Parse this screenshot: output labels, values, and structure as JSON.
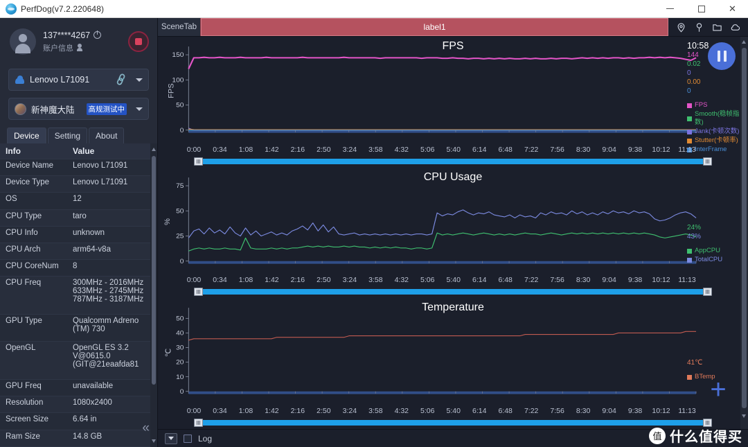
{
  "window": {
    "title": "PerfDog(v7.2.220648)",
    "logo_icon": "perfdog-logo-icon",
    "minimize_label": "—",
    "maximize_label": "□",
    "close_label": "✕"
  },
  "account": {
    "user_id": "137****4267",
    "power_icon": "power-icon",
    "sub_label": "账户信息",
    "person_icon": "person-add-icon",
    "stop_button_label": "stop-recording"
  },
  "device_select": {
    "icon": "android-icon",
    "value": "Lenovo L71091",
    "link_icon": "usb-link-icon",
    "caret_icon": "chevron-down-icon"
  },
  "app_select": {
    "icon": "app-thumbnail-icon",
    "value": "新神魔大陆",
    "badge": "高规测试中",
    "caret_icon": "chevron-down-icon"
  },
  "tabs": [
    {
      "label": "Device",
      "active": true
    },
    {
      "label": "Setting",
      "active": false
    },
    {
      "label": "About",
      "active": false
    }
  ],
  "info_table": {
    "headers": [
      "Info",
      "Value"
    ],
    "rows": [
      {
        "key": "Device Name",
        "value": "Lenovo L71091"
      },
      {
        "key": "Device Type",
        "value": "Lenovo L71091"
      },
      {
        "key": "OS",
        "value": "12"
      },
      {
        "key": "CPU Type",
        "value": "taro"
      },
      {
        "key": "CPU Info",
        "value": "unknown"
      },
      {
        "key": "CPU Arch",
        "value": "arm64-v8a"
      },
      {
        "key": "CPU CoreNum",
        "value": "8"
      },
      {
        "key": "CPU Freq",
        "value": "300MHz - 2016MHz 633MHz - 2745MHz 787MHz - 3187MHz"
      },
      {
        "key": "GPU Type",
        "value": "Qualcomm Adreno (TM) 730"
      },
      {
        "key": "OpenGL",
        "value": "OpenGL ES 3.2 V@0615.0 (GIT@21eaafda81"
      },
      {
        "key": "GPU Freq",
        "value": "unavailable"
      },
      {
        "key": "Resolution",
        "value": "1080x2400"
      },
      {
        "key": "Screen Size",
        "value": "6.64 in"
      },
      {
        "key": "Ram Size",
        "value": "14.8 GB"
      }
    ]
  },
  "collapse_button": "«",
  "scenebar": {
    "scene_tab_label": "SceneTab",
    "label_name": "label1",
    "icons": [
      "location-pin-icon",
      "marker-pin-icon",
      "folder-icon",
      "cloud-icon"
    ]
  },
  "pause_button": "pause-button",
  "add_button": "+",
  "statusbar": {
    "dropdown_icon": "chevron-down-icon",
    "log_checkbox_label": "Log",
    "log_checked": false
  },
  "watermark": {
    "mark": "值",
    "text": "什么值得买"
  },
  "x_axis": {
    "ticks": [
      "0:00",
      "0:34",
      "1:08",
      "1:42",
      "2:16",
      "2:50",
      "3:24",
      "3:58",
      "4:32",
      "5:06",
      "5:40",
      "6:14",
      "6:48",
      "7:22",
      "7:56",
      "8:30",
      "9:04",
      "9:38",
      "10:12",
      "11:13"
    ]
  },
  "chart_data": [
    {
      "type": "line",
      "title": "FPS",
      "ylabel": "FPS",
      "xlabel": "",
      "ylim": [
        0,
        160
      ],
      "yticks": [
        0,
        50,
        100,
        150
      ],
      "grid": false,
      "legend_position": "right",
      "timestamp": "10:58",
      "current_values": [
        {
          "label": "FPS",
          "value": "144",
          "color": "#e455c8"
        },
        {
          "label": "Smooth(稳帧指数)",
          "value": "0.02",
          "color": "#3fbf6f"
        },
        {
          "label": "Jank(卡顿次数)",
          "value": "0",
          "color": "#7b74e0"
        },
        {
          "label": "Stutter(卡顿率)",
          "value": "0.00",
          "color": "#e08a33"
        },
        {
          "label": "InterFrame",
          "value": "0",
          "color": "#4a8fd8"
        }
      ],
      "series": [
        {
          "name": "FPS",
          "color": "#e455c8",
          "values": [
            122,
            144,
            144,
            145,
            144,
            144,
            145,
            144,
            144,
            144,
            145,
            144,
            144,
            144,
            144,
            145,
            144,
            144,
            144,
            144,
            144,
            144,
            145,
            144,
            144,
            144,
            144,
            144,
            144,
            144,
            145,
            144,
            144,
            144,
            144,
            144,
            144,
            143,
            144,
            144,
            144,
            144,
            144,
            144,
            144,
            143,
            144,
            144,
            144,
            143,
            143,
            144,
            143,
            143,
            142,
            143,
            143,
            142,
            143,
            142,
            143,
            142,
            143,
            142,
            142,
            143,
            142,
            143,
            142,
            142,
            143,
            142,
            143,
            143,
            142,
            143,
            144,
            143,
            144,
            143,
            144,
            143,
            144,
            144,
            143,
            144,
            143,
            144,
            144,
            145,
            144,
            145,
            144,
            145,
            144,
            143,
            141,
            139,
            144
          ]
        },
        {
          "name": "Smooth(稳帧指数)",
          "color": "#3fbf6f",
          "values": [
            0.02,
            0.02,
            0.02,
            0.02,
            0.02,
            0.02,
            0.02,
            0.02,
            0.02,
            0.02,
            0.02,
            0.02,
            0.02,
            0.02,
            0.02,
            0.02,
            0.02,
            0.02,
            0.02,
            0.02,
            0.02,
            0.02,
            0.02,
            0.02,
            0.02,
            0.02,
            0.02,
            0.02,
            0.02,
            0.02,
            0.02,
            0.02,
            0.02,
            0.02,
            0.02,
            0.02,
            0.02,
            0.02,
            0.02,
            0.02,
            0.02,
            0.02,
            0.02,
            0.02,
            0.02,
            0.02,
            0.02,
            0.02,
            0.02,
            0.02,
            0.02,
            0.02,
            0.02,
            0.02,
            0.02,
            0.02,
            0.02,
            0.02,
            0.02,
            0.02,
            0.02,
            0.02,
            0.02,
            0.02,
            0.02,
            0.02,
            0.02,
            0.02,
            0.02,
            0.02,
            0.02,
            0.02,
            0.02,
            0.02,
            0.02,
            0.02,
            0.02,
            0.02,
            0.02,
            0.02,
            0.02,
            0.02,
            0.02,
            0.02,
            0.02,
            0.02,
            0.02,
            0.02,
            0.02,
            0.02,
            0.02,
            0.02,
            0.02,
            0.02,
            0.02,
            0.02,
            0.02,
            0.02,
            0.02
          ]
        },
        {
          "name": "Jank(卡顿次数)",
          "color": "#7b74e0",
          "values": [
            4,
            0,
            0,
            0,
            0,
            0,
            0,
            0,
            0,
            0,
            0,
            0,
            0,
            0,
            0,
            0,
            0,
            0,
            0,
            0,
            0,
            0,
            0,
            0,
            0,
            0,
            0,
            0,
            0,
            0,
            0,
            0,
            0,
            0,
            0,
            0,
            0,
            0,
            0,
            0,
            0,
            0,
            0,
            0,
            0,
            0,
            0,
            0,
            0,
            0,
            0,
            0,
            0,
            0,
            0,
            0,
            0,
            0,
            0,
            0,
            0,
            0,
            0,
            0,
            0,
            0,
            0,
            0,
            0,
            0,
            0,
            0,
            0,
            0,
            0,
            0,
            0,
            0,
            0,
            0,
            0,
            0,
            0,
            0,
            0,
            0,
            0,
            0,
            0,
            0,
            0,
            0,
            0,
            0,
            0,
            0,
            0,
            0,
            0
          ]
        },
        {
          "name": "Stutter(卡顿率)",
          "color": "#e08a33",
          "values": [
            2,
            1.2,
            1,
            1,
            1,
            1,
            1,
            1,
            1,
            1,
            1,
            1,
            1,
            1,
            1,
            1,
            1,
            1,
            1,
            1,
            1,
            1,
            1,
            1,
            1,
            1,
            1,
            1,
            1,
            1,
            1,
            1,
            1,
            1,
            1,
            1,
            1,
            1,
            1,
            1,
            1,
            1,
            1,
            1,
            1,
            1,
            1,
            1,
            1,
            1,
            1,
            1,
            1,
            1,
            1,
            1,
            1,
            1,
            1,
            1,
            1,
            1,
            1,
            1,
            1,
            1,
            1,
            1,
            1,
            1,
            1,
            1,
            1,
            1,
            1,
            1,
            1,
            1,
            1,
            1,
            1,
            1,
            1,
            1,
            1,
            1,
            1,
            1,
            1,
            1,
            1,
            1,
            1,
            1,
            1,
            1,
            1,
            1,
            1
          ]
        },
        {
          "name": "InterFrame",
          "color": "#4a8fd8",
          "values": [
            0,
            0,
            0,
            0,
            0,
            0,
            0,
            0,
            0,
            0,
            0,
            0,
            0,
            0,
            0,
            0,
            0,
            0,
            0,
            0,
            0,
            0,
            0,
            0,
            0,
            0,
            0,
            0,
            0,
            0,
            0,
            0,
            0,
            0,
            0,
            0,
            0,
            0,
            0,
            0,
            0,
            0,
            0,
            0,
            0,
            0,
            0,
            0,
            0,
            0,
            0,
            0,
            0,
            0,
            0,
            0,
            0,
            0,
            0,
            0,
            0,
            0,
            0,
            0,
            0,
            0,
            0,
            0,
            0,
            0,
            0,
            0,
            0,
            0,
            0,
            0,
            0,
            0,
            0,
            0,
            0,
            0,
            0,
            0,
            0,
            0,
            0,
            0,
            0,
            0,
            0,
            0,
            0,
            0,
            0,
            0,
            0,
            0,
            0
          ]
        }
      ]
    },
    {
      "type": "line",
      "title": "CPU Usage",
      "ylabel": "%",
      "xlabel": "",
      "ylim": [
        0,
        80
      ],
      "yticks": [
        0,
        25,
        50,
        75
      ],
      "grid": false,
      "legend_position": "right",
      "current_values": [
        {
          "label": "AppCPU",
          "value": "24%",
          "color": "#3fbf6f"
        },
        {
          "label": "TotalCPU",
          "value": "43%",
          "color": "#7b8ae0"
        }
      ],
      "series": [
        {
          "name": "AppCPU",
          "color": "#3fbf6f",
          "values": [
            10,
            12,
            13,
            12,
            13,
            12,
            12,
            13,
            12,
            12,
            11,
            23,
            13,
            12,
            12,
            12,
            13,
            12,
            13,
            12,
            13,
            13,
            14,
            15,
            14,
            15,
            14,
            15,
            14,
            14,
            15,
            14,
            15,
            14,
            14,
            13,
            14,
            13,
            14,
            13,
            14,
            13,
            13,
            12,
            13,
            13,
            12,
            13,
            28,
            26,
            27,
            26,
            27,
            28,
            27,
            26,
            27,
            28,
            27,
            26,
            27,
            26,
            27,
            26,
            27,
            28,
            27,
            27,
            26,
            27,
            28,
            27,
            26,
            27,
            28,
            27,
            28,
            27,
            28,
            27,
            28,
            27,
            28,
            27,
            28,
            27,
            28,
            27,
            28,
            27,
            26,
            24,
            23,
            24,
            25,
            26,
            27,
            26,
            24
          ]
        },
        {
          "name": "TotalCPU",
          "color": "#7b8ae0",
          "values": [
            23,
            30,
            32,
            27,
            33,
            28,
            31,
            27,
            34,
            28,
            25,
            33,
            26,
            30,
            25,
            27,
            29,
            26,
            28,
            26,
            30,
            32,
            35,
            31,
            38,
            30,
            36,
            29,
            34,
            27,
            26,
            27,
            28,
            26,
            27,
            26,
            27,
            26,
            27,
            26,
            27,
            26,
            27,
            26,
            27,
            27,
            26,
            27,
            48,
            45,
            47,
            46,
            49,
            51,
            48,
            46,
            48,
            47,
            49,
            46,
            45,
            44,
            46,
            43,
            46,
            44,
            45,
            43,
            48,
            46,
            49,
            47,
            48,
            46,
            50,
            47,
            49,
            46,
            48,
            46,
            49,
            47,
            50,
            48,
            49,
            47,
            50,
            48,
            49,
            47,
            42,
            40,
            41,
            43,
            46,
            48,
            49,
            47,
            43
          ]
        }
      ]
    },
    {
      "type": "line",
      "title": "Temperature",
      "ylabel": "℃",
      "xlabel": "",
      "ylim": [
        0,
        55
      ],
      "yticks": [
        0,
        10,
        20,
        30,
        40,
        50
      ],
      "grid": false,
      "legend_position": "right",
      "current_values": [
        {
          "label": "BTemp",
          "value": "41℃",
          "color": "#e07a5a"
        }
      ],
      "series": [
        {
          "name": "BTemp",
          "color": "#c05a50",
          "values": [
            35,
            36,
            36,
            36,
            36,
            36,
            36,
            36,
            36,
            36,
            36,
            36,
            36,
            36,
            36,
            36,
            36,
            37,
            37,
            37,
            37,
            37,
            37,
            37,
            37,
            37,
            37,
            37,
            37,
            37,
            37,
            38,
            38,
            38,
            38,
            38,
            38,
            38,
            38,
            38,
            38,
            38,
            38,
            38,
            38,
            38,
            38,
            38,
            38,
            38,
            38,
            38,
            38,
            38,
            38,
            38,
            38,
            38,
            38,
            38,
            38,
            38,
            38,
            38,
            38,
            39,
            39,
            39,
            39,
            39,
            39,
            39,
            39,
            39,
            39,
            39,
            39,
            39,
            39,
            39,
            39,
            39,
            39,
            40,
            40,
            40,
            40,
            40,
            40,
            40,
            40,
            40,
            40,
            40,
            40,
            40,
            41,
            41,
            41
          ]
        }
      ]
    }
  ]
}
